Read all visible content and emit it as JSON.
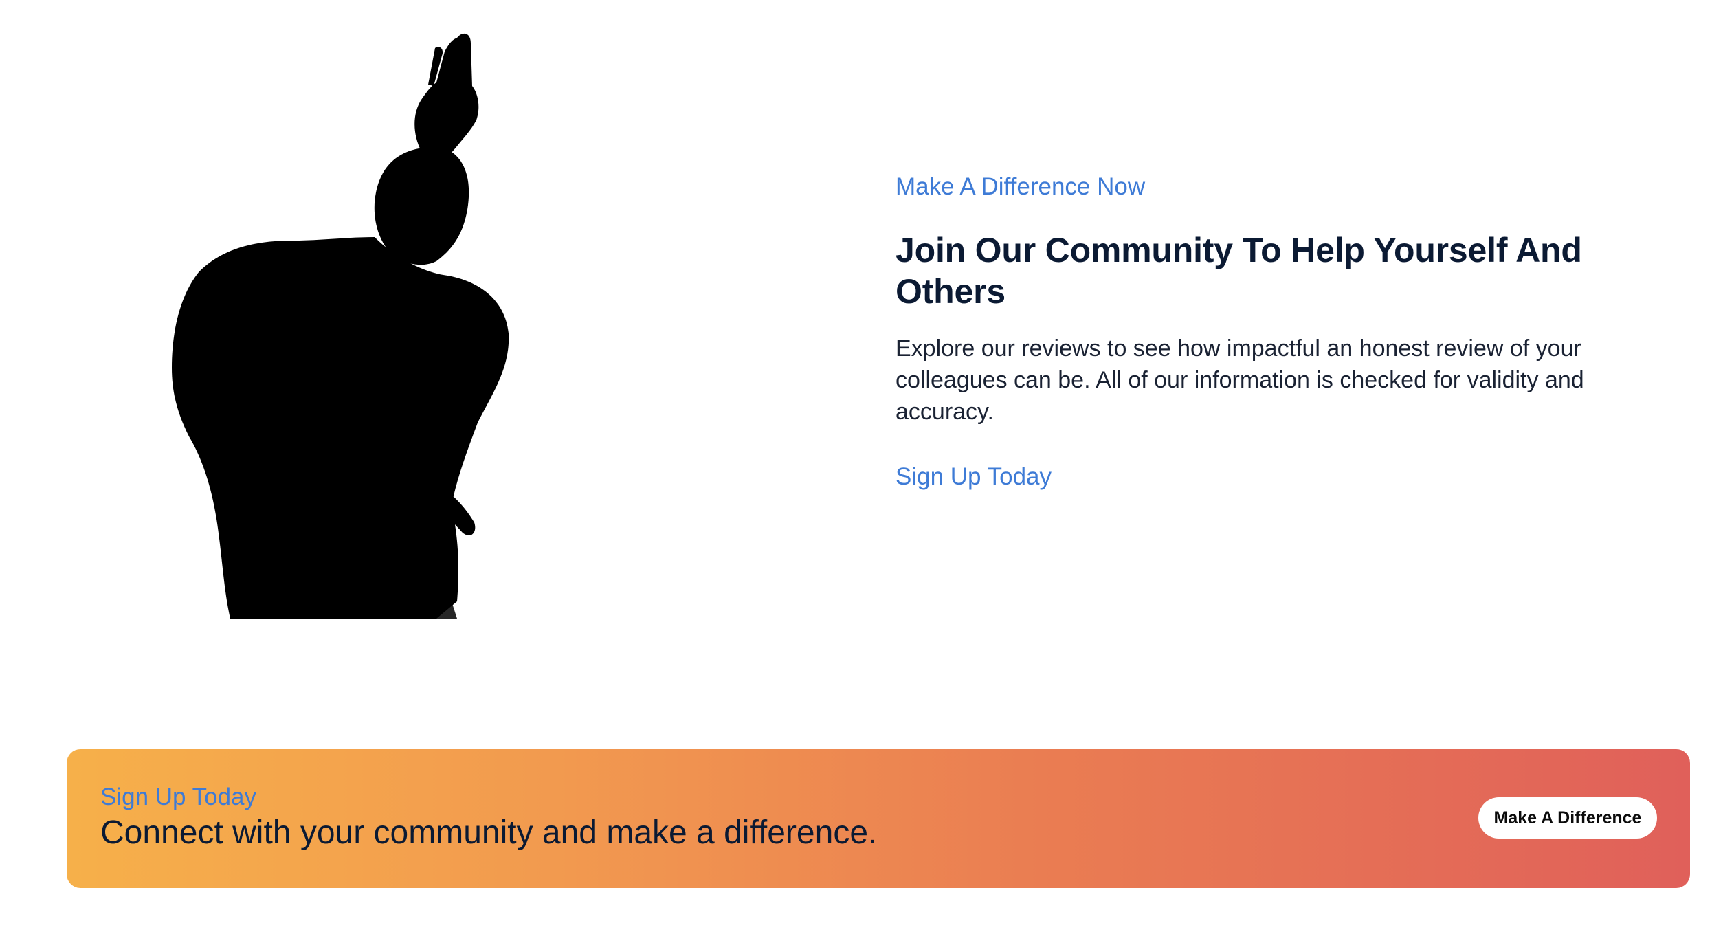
{
  "hero": {
    "image_description_icon": "silhouette-figure-image"
  },
  "content": {
    "eyebrow": "Make A Difference Now",
    "heading": "Join Our Community To Help Yourself And Others",
    "body": "Explore our reviews to see how impactful an honest review of your colleagues can be. All of our information is checked for validity and accuracy.",
    "cta_label": "Sign Up Today"
  },
  "banner": {
    "eyebrow": "Sign Up Today",
    "text": "Connect with your community and make a difference.",
    "button_label": "Make A Difference"
  },
  "colors": {
    "accent_blue": "#3e7bd6",
    "heading_navy": "#0b1a33",
    "banner_start": "#f6b04a",
    "banner_end": "#e0605a"
  }
}
